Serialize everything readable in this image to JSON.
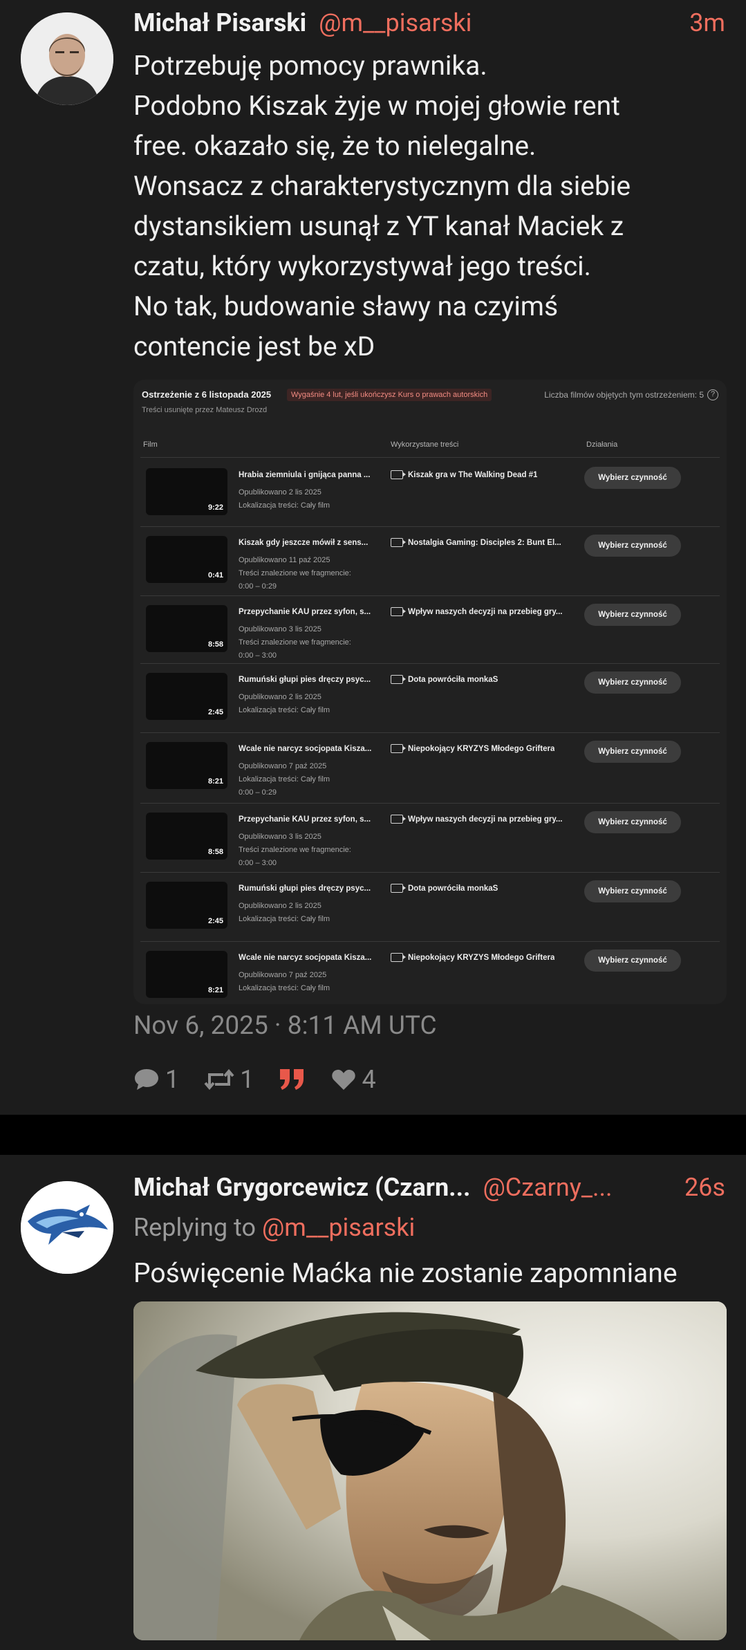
{
  "post1": {
    "author_name": "Michał Pisarski",
    "author_handle": "@m__pisarski",
    "time_ago": "3m",
    "text_lines": [
      "Potrzebuję pomocy prawnika.",
      "Podobno Kiszak żyje w mojej głowie rent",
      "free. okazało się, że to nielegalne.",
      "Wonsacz z charakterystycznym dla siebie",
      "dystansikiem usunął z YT kanał Maciek z",
      "czatu, który wykorzystywał jego treści.",
      "No tak, budowanie sławy na czyimś",
      "contencie jest be xD"
    ],
    "timestamp": "Nov 6, 2025 · 8:11 AM UTC",
    "stats": {
      "replies": "1",
      "reposts": "1",
      "likes": "4"
    },
    "colors": {
      "accent": "#ef6e5e",
      "quote_icon": "#e8584a"
    }
  },
  "screenshot": {
    "title": "Ostrzeżenie z 6 listopada 2025",
    "badge": "Wygaśnie 4 lut, jeśli ukończysz Kurs o prawach autorskich",
    "count": "Liczba filmów objętych tym ostrzeżeniem: 5",
    "help": "?",
    "subtitle": "Treści usunięte przez Mateusz Drozd",
    "col_film": "Film",
    "col_used": "Wykorzystane treści",
    "col_actions": "Działania",
    "rows": [
      {
        "duration": "9:22",
        "title": "Hrabia ziemniula i gnijąca panna ...",
        "meta": [
          "Opublikowano 2 lis 2025",
          "Lokalizacja treści: Cały film"
        ],
        "used": "Kiszak gra w The Walking Dead #1",
        "action": "Wybierz czynność"
      },
      {
        "duration": "0:41",
        "title": "Kiszak gdy jeszcze mówił z sens...",
        "meta": [
          "Opublikowano 11 paź 2025",
          "Treści znalezione we fragmencie:",
          "0:00 – 0:29"
        ],
        "used": "Nostalgia Gaming: Disciples 2: Bunt El...",
        "action": "Wybierz czynność"
      },
      {
        "duration": "8:58",
        "title": "Przepychanie KAU przez syfon, s...",
        "meta": [
          "Opublikowano 3 lis 2025",
          "Treści znalezione we fragmencie:",
          "0:00 – 3:00"
        ],
        "used": "Wpływ naszych decyzji na przebieg gry...",
        "action": "Wybierz czynność"
      },
      {
        "duration": "2:45",
        "title": "Rumuński głupi pies dręczy psyc...",
        "meta": [
          "Opublikowano 2 lis 2025",
          "Lokalizacja treści: Cały film"
        ],
        "used": "Dota powróciła monkaS",
        "action": "Wybierz czynność"
      },
      {
        "duration": "8:21",
        "title": "Wcale nie narcyz socjopata Kisza...",
        "meta": [
          "Opublikowano 7 paź 2025",
          "Lokalizacja treści: Cały film",
          "0:00 – 0:29"
        ],
        "used": "Niepokojący KRYZYS Młodego Griftera",
        "action": "Wybierz czynność"
      },
      {
        "duration": "8:58",
        "title": "Przepychanie KAU przez syfon, s...",
        "meta": [
          "Opublikowano 3 lis 2025",
          "Treści znalezione we fragmencie:",
          "0:00 – 3:00"
        ],
        "used": "Wpływ naszych decyzji na przebieg gry...",
        "action": "Wybierz czynność"
      },
      {
        "duration": "2:45",
        "title": "Rumuński głupi pies dręczy psyc...",
        "meta": [
          "Opublikowano 2 lis 2025",
          "Lokalizacja treści: Cały film"
        ],
        "used": "Dota powróciła monkaS",
        "action": "Wybierz czynność"
      },
      {
        "duration": "8:21",
        "title": "Wcale nie narcyz socjopata Kisza...",
        "meta": [
          "Opublikowano 7 paź 2025",
          "Lokalizacja treści: Cały film"
        ],
        "used": "Niepokojący KRYZYS Młodego Griftera",
        "action": "Wybierz czynność"
      }
    ]
  },
  "post2": {
    "author_name": "Michał Grygorcewicz (Czarn...",
    "author_handle": "@Czarny_...",
    "time_ago": "26s",
    "replying_prefix": "Replying to ",
    "replying_handle": "@m__pisarski",
    "text": "Poświęcenie Maćka nie zostanie zapomniane"
  }
}
